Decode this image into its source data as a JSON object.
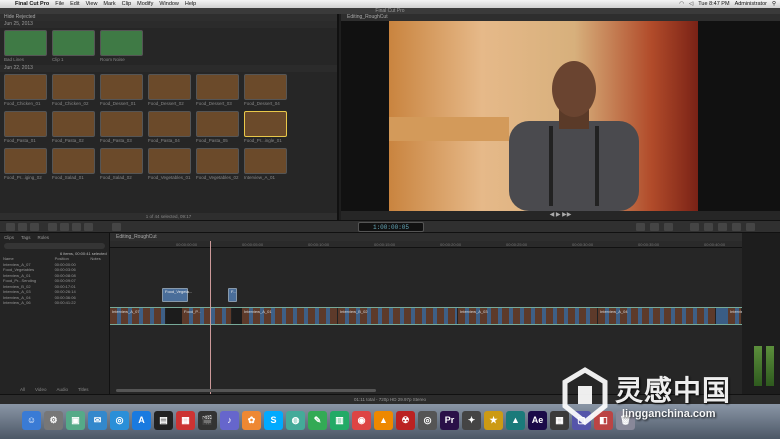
{
  "menubar": {
    "app": "Final Cut Pro",
    "items": [
      "File",
      "Edit",
      "View",
      "Mark",
      "Clip",
      "Modify",
      "Window",
      "Help"
    ],
    "clock": "Tue 8:47 PM",
    "user": "Administrator"
  },
  "window_title": "Final Cut Pro",
  "browser": {
    "header": "Hide Rejected",
    "sections": [
      {
        "label": "Jun 25, 2013",
        "clips": [
          "Bad Lines",
          "Clip 1",
          "Room Noise"
        ]
      },
      {
        "label": "Jun 22, 2013"
      }
    ],
    "grid_labels": [
      [
        "Food_Chicken_01",
        "Food_Chicken_02",
        "Food_Dessert_01",
        "Food_Dessert_02",
        "Food_Dessert_03",
        "Food_Dessert_04"
      ],
      [
        "Food_Pasta_01",
        "Food_Pasta_02",
        "Food_Pasta_03",
        "Food_Pasta_04",
        "Food_Pasta_05",
        "Food_Pr...ingle_01"
      ],
      [
        "Food_Pr...iging_02",
        "Food_Salad_01",
        "Food_Salad_02",
        "Food_Vegetables_01",
        "Food_Vegetables_02",
        "Interview_A_01"
      ]
    ],
    "footer": "1 of 44 selected, 09:17"
  },
  "viewer": {
    "header": "Editing_RoughCut"
  },
  "toolbar": {
    "timecode": "1:00:00:05"
  },
  "index": {
    "tabs": [
      "Clips",
      "Tags",
      "Roles"
    ],
    "summary": "6 items, 00:00:41 selected",
    "columns": [
      "Name",
      "Position",
      "Notes"
    ],
    "rows": [
      [
        "Interview_A_07",
        "00:00:00:00",
        ""
      ],
      [
        "Food_Vegetables",
        "00:00:03:06",
        ""
      ],
      [
        "Interview_A_01",
        "00:00:08:08",
        ""
      ],
      [
        "Food_Pr...Sending",
        "00:00:09:07",
        ""
      ],
      [
        "Interview_B_02",
        "00:00:17:01",
        ""
      ],
      [
        "Interview_A_03",
        "00:00:26:14",
        ""
      ],
      [
        "Interview_A_04",
        "00:00:36:06",
        ""
      ],
      [
        "Interview_A_06",
        "00:00:41:22",
        ""
      ]
    ],
    "bottom_tabs": [
      "All",
      "Video",
      "Audio",
      "Titles"
    ]
  },
  "timeline": {
    "header": "Editing_RoughCut",
    "ruler": [
      "00:00:00:00",
      "00:00:05:00",
      "00:00:10:00",
      "00:00:15:00",
      "00:00:20:00",
      "00:00:25:00",
      "00:00:30:00",
      "00:00:35:00",
      "00:00:40:00",
      "00:00:45:00"
    ],
    "connected": [
      "Food_Vegeta...",
      "F..."
    ],
    "primary": [
      "Interview_A_07",
      "Food_P...",
      "Interview_A_01",
      "Interview_B_02",
      "Interview_A_03",
      "Interview_A_04",
      "Interview_A_06"
    ]
  },
  "status": "01:11 total - 720p HD 29.97p Stereo",
  "dock": {
    "icons": [
      {
        "name": "finder-icon",
        "color": "#3a7bd5",
        "glyph": "☺"
      },
      {
        "name": "system-preferences-icon",
        "color": "#777",
        "glyph": "⚙"
      },
      {
        "name": "preview-icon",
        "color": "#5a8",
        "glyph": "▣"
      },
      {
        "name": "mail-icon",
        "color": "#38c",
        "glyph": "✉"
      },
      {
        "name": "safari-icon",
        "color": "#2a8fd8",
        "glyph": "◎"
      },
      {
        "name": "app-store-icon",
        "color": "#1a7ae0",
        "glyph": "A"
      },
      {
        "name": "final-cut-pro-icon",
        "color": "#222",
        "glyph": "▤"
      },
      {
        "name": "calendar-icon",
        "color": "#c33",
        "glyph": "▦"
      },
      {
        "name": "claquette-icon",
        "color": "#333",
        "glyph": "🎬"
      },
      {
        "name": "itunes-icon",
        "color": "#66c",
        "glyph": "♪"
      },
      {
        "name": "photos-icon",
        "color": "#e83",
        "glyph": "✿"
      },
      {
        "name": "skype-icon",
        "color": "#0af",
        "glyph": "S"
      },
      {
        "name": "maps-icon",
        "color": "#4a9",
        "glyph": "◍"
      },
      {
        "name": "messages-icon",
        "color": "#3a5",
        "glyph": "✎"
      },
      {
        "name": "numbers-icon",
        "color": "#2a6",
        "glyph": "▥"
      },
      {
        "name": "chrome-icon",
        "color": "#d44",
        "glyph": "◉"
      },
      {
        "name": "vlc-icon",
        "color": "#e80",
        "glyph": "▲"
      },
      {
        "name": "burn-icon",
        "color": "#b22",
        "glyph": "☢"
      },
      {
        "name": "dvd-player-icon",
        "color": "#555",
        "glyph": "◎"
      },
      {
        "name": "premiere-icon",
        "color": "#2a1048",
        "glyph": "Pr"
      },
      {
        "name": "motion-icon",
        "color": "#444",
        "glyph": "✦"
      },
      {
        "name": "imovie-icon",
        "color": "#cc9a14",
        "glyph": "★"
      },
      {
        "name": "compressor-icon",
        "color": "#1a7a7a",
        "glyph": "▲"
      },
      {
        "name": "after-effects-icon",
        "color": "#1a0a48",
        "glyph": "Ae"
      },
      {
        "name": "utility-icon",
        "color": "#3a3a3a",
        "glyph": "▦"
      },
      {
        "name": "screenshot-icon",
        "color": "#55a",
        "glyph": "▢"
      },
      {
        "name": "photo-booth-icon",
        "color": "#b44",
        "glyph": "◧"
      },
      {
        "name": "trash-icon",
        "color": "#889",
        "glyph": "🗑"
      }
    ]
  },
  "watermark": {
    "title": "灵感中国",
    "url": "lingganchina.com"
  },
  "colors": {
    "selection": "#e9c84a",
    "clip_blue": "#3a5d85",
    "connected": "#4a6e9a"
  }
}
